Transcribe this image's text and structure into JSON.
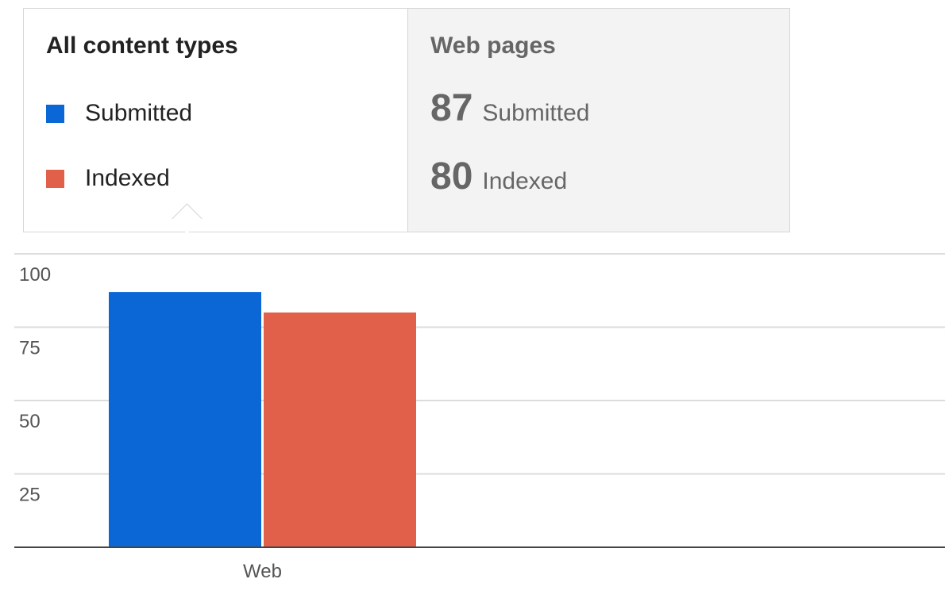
{
  "summary": {
    "all_tab": {
      "title": "All content types",
      "legend": [
        {
          "label": "Submitted",
          "color": "#0b67d6"
        },
        {
          "label": "Indexed",
          "color": "#e0604a"
        }
      ]
    },
    "web_tab": {
      "title": "Web pages",
      "submitted_count": "87",
      "submitted_label": "Submitted",
      "indexed_count": "80",
      "indexed_label": "Indexed"
    }
  },
  "chart_data": {
    "type": "bar",
    "categories": [
      "Web"
    ],
    "series": [
      {
        "name": "Submitted",
        "values": [
          87
        ],
        "color": "#0b67d6"
      },
      {
        "name": "Indexed",
        "values": [
          80
        ],
        "color": "#e0604a"
      }
    ],
    "yticks": [
      25,
      50,
      75,
      100
    ],
    "ylim": [
      0,
      100
    ],
    "grid": true,
    "legend_placement": "top-left"
  }
}
